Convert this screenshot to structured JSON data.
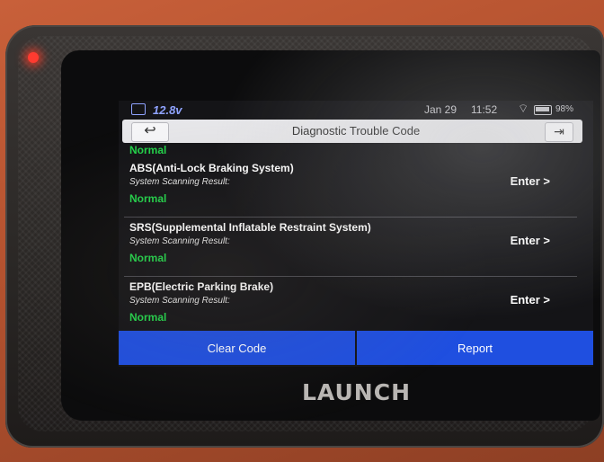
{
  "status_bar": {
    "voltage": "12.8v",
    "date": "Jan 29",
    "time": "11:52",
    "battery": "98%"
  },
  "header": {
    "back_icon": "back-arrow-icon",
    "title": "Diagnostic Trouble Code",
    "exit_icon": "exit-icon"
  },
  "list": {
    "previous_status": "Normal",
    "items": [
      {
        "name": "ABS(Anti-Lock Braking System)",
        "result_label": "System Scanning Result:",
        "status": "Normal",
        "action": "Enter >"
      },
      {
        "name": "SRS(Supplemental Inflatable Restraint System)",
        "result_label": "System Scanning Result:",
        "status": "Normal",
        "action": "Enter >"
      },
      {
        "name": "EPB(Electric Parking Brake)",
        "result_label": "System Scanning Result:",
        "status": "Normal",
        "action": "Enter >"
      }
    ]
  },
  "footer": {
    "clear_label": "Clear Code",
    "report_label": "Report"
  },
  "device": {
    "brand": "LAUNCH"
  },
  "colors": {
    "accent_blue": "#1f4fe0",
    "status_green": "#22d34a",
    "device_orange": "#c25a35"
  }
}
